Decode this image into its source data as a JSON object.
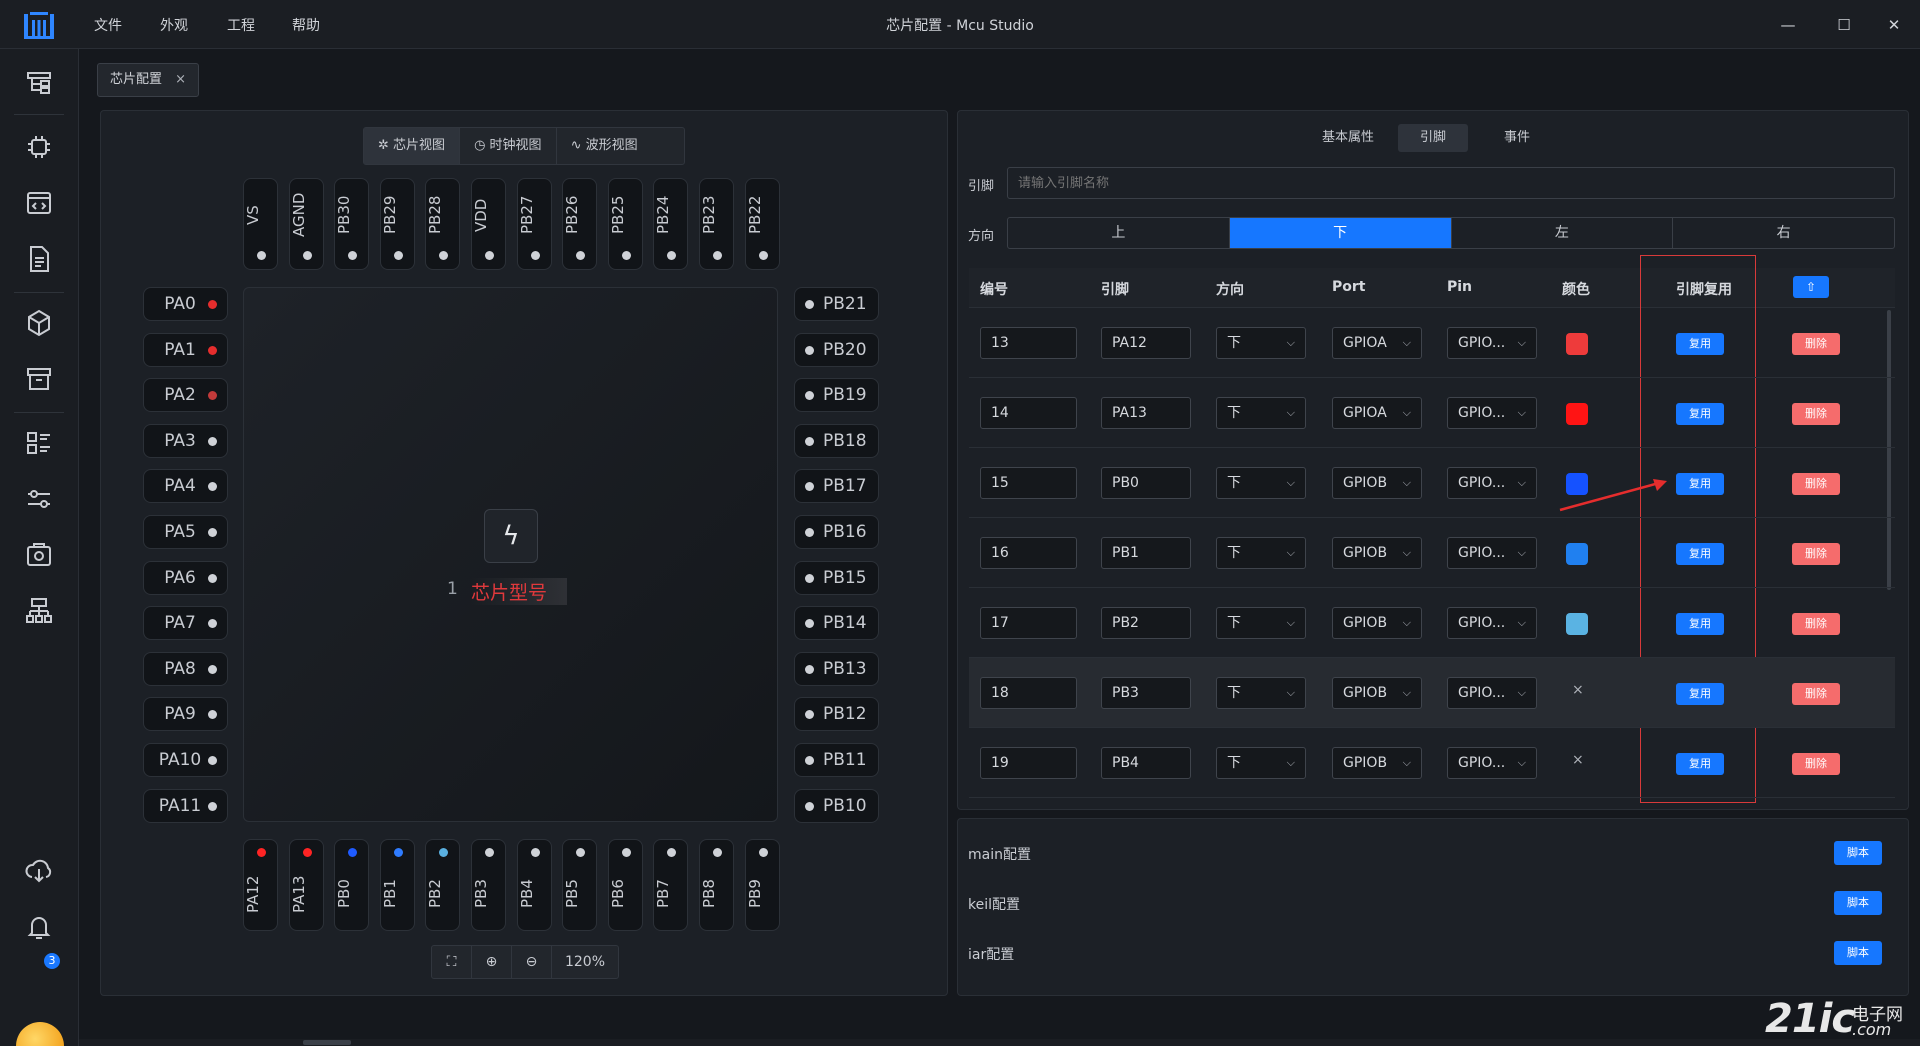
{
  "window": {
    "title": "芯片配置 - Mcu Studio"
  },
  "menu": [
    "文件",
    "外观",
    "工程",
    "帮助"
  ],
  "window_controls": {
    "minimize": "—",
    "maximize": "☐",
    "close": "✕"
  },
  "sidebar": {
    "notification_count": "3"
  },
  "doc_tab": {
    "label": "芯片配置",
    "close": "×"
  },
  "view_tabs": [
    {
      "label": "芯片视图",
      "icon": "gear-icon",
      "glyph": "✲"
    },
    {
      "label": "时钟视图",
      "icon": "clock-icon",
      "glyph": "◷"
    },
    {
      "label": "波形视图",
      "icon": "waveform-icon",
      "glyph": "∿"
    }
  ],
  "chip": {
    "number": "1",
    "label": "芯片型号",
    "logo_glyph": "ϟ",
    "top_pins": [
      "VS",
      "AGND",
      "PB30",
      "PB29",
      "PB28",
      "VDD",
      "PB27",
      "PB26",
      "PB25",
      "PB24",
      "PB23",
      "PB22"
    ],
    "left_pins": [
      {
        "name": "PA0",
        "color": "#e52d2d"
      },
      {
        "name": "PA1",
        "color": "#e52d2d"
      },
      {
        "name": "PA2",
        "color": "#c23a3a"
      },
      {
        "name": "PA3",
        "color": "#cfd2d7"
      },
      {
        "name": "PA4",
        "color": "#cfd2d7"
      },
      {
        "name": "PA5",
        "color": "#cfd2d7"
      },
      {
        "name": "PA6",
        "color": "#cfd2d7"
      },
      {
        "name": "PA7",
        "color": "#cfd2d7"
      },
      {
        "name": "PA8",
        "color": "#cfd2d7"
      },
      {
        "name": "PA9",
        "color": "#cfd2d7"
      },
      {
        "name": "PA10",
        "color": "#cfd2d7"
      },
      {
        "name": "PA11",
        "color": "#cfd2d7"
      }
    ],
    "right_pins": [
      "PB21",
      "PB20",
      "PB19",
      "PB18",
      "PB17",
      "PB16",
      "PB15",
      "PB14",
      "PB13",
      "PB12",
      "PB11",
      "PB10"
    ],
    "bottom_pins": [
      {
        "name": "PA12",
        "color": "#ff2424"
      },
      {
        "name": "PA13",
        "color": "#ff2424"
      },
      {
        "name": "PB0",
        "color": "#1f5bff"
      },
      {
        "name": "PB1",
        "color": "#2f7cff"
      },
      {
        "name": "PB2",
        "color": "#5ab0e0"
      },
      {
        "name": "PB3",
        "color": "#cfd2d7"
      },
      {
        "name": "PB4",
        "color": "#cfd2d7"
      },
      {
        "name": "PB5",
        "color": "#cfd2d7"
      },
      {
        "name": "PB6",
        "color": "#cfd2d7"
      },
      {
        "name": "PB7",
        "color": "#cfd2d7"
      },
      {
        "name": "PB8",
        "color": "#cfd2d7"
      },
      {
        "name": "PB9",
        "color": "#cfd2d7"
      }
    ]
  },
  "zoom": {
    "fit": "⛶",
    "zoom_in": "⊕",
    "zoom_out": "⊖",
    "value": "120%"
  },
  "prop_tabs": [
    "基本属性",
    "引脚",
    "事件"
  ],
  "pin_filter": {
    "label": "引脚",
    "placeholder": "请输入引脚名称"
  },
  "direction": {
    "label": "方向",
    "options": [
      "上",
      "下",
      "左",
      "右"
    ],
    "selected": "下"
  },
  "table": {
    "headers": [
      "编号",
      "引脚",
      "方向",
      "Port",
      "Pin",
      "颜色",
      "引脚复用"
    ],
    "upload_icon": "⇧",
    "mux_label": "复用",
    "delete_label": "删除",
    "rows": [
      {
        "id": "13",
        "pin": "PA12",
        "dir": "下",
        "port": "GPIOA",
        "pinsel": "GPIO...",
        "color": "#ee3b3b",
        "color_text": ""
      },
      {
        "id": "14",
        "pin": "PA13",
        "dir": "下",
        "port": "GPIOA",
        "pinsel": "GPIO...",
        "color": "#ff1414",
        "color_text": ""
      },
      {
        "id": "15",
        "pin": "PB0",
        "dir": "下",
        "port": "GPIOB",
        "pinsel": "GPIO...",
        "color": "#1552ff",
        "color_text": ""
      },
      {
        "id": "16",
        "pin": "PB1",
        "dir": "下",
        "port": "GPIOB",
        "pinsel": "GPIO...",
        "color": "#2080f0",
        "color_text": ""
      },
      {
        "id": "17",
        "pin": "PB2",
        "dir": "下",
        "port": "GPIOB",
        "pinsel": "GPIO...",
        "color": "#5ab3e3",
        "color_text": ""
      },
      {
        "id": "18",
        "pin": "PB3",
        "dir": "下",
        "port": "GPIOB",
        "pinsel": "GPIO...",
        "color": "",
        "color_text": "×"
      },
      {
        "id": "19",
        "pin": "PB4",
        "dir": "下",
        "port": "GPIOB",
        "pinsel": "GPIO...",
        "color": "",
        "color_text": "×"
      }
    ]
  },
  "configs": [
    {
      "label": "main配置",
      "button": "脚本"
    },
    {
      "label": "keil配置",
      "button": "脚本"
    },
    {
      "label": "iar配置",
      "button": "脚本"
    }
  ],
  "watermark": {
    "brand": "21ic",
    "cn": "电子网",
    "url": ".com"
  },
  "colors": {
    "accent": "#1677ff",
    "danger": "#f56c6c",
    "annotation": "#d83a3a"
  }
}
